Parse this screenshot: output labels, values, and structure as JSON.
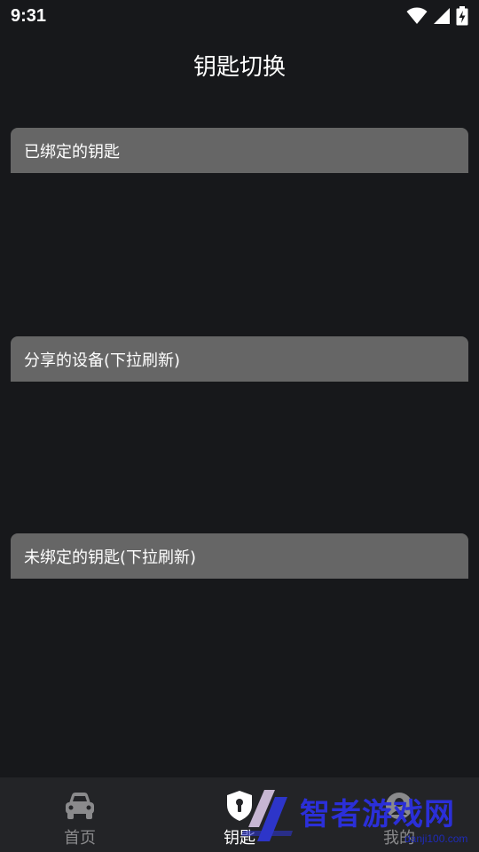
{
  "status_bar": {
    "time": "9:31",
    "icons": [
      "wifi-icon",
      "signal-icon",
      "battery-charging-icon"
    ]
  },
  "header": {
    "title": "钥匙切换"
  },
  "sections": {
    "bound": {
      "title": "已绑定的钥匙"
    },
    "shared": {
      "title": "分享的设备(下拉刷新)"
    },
    "unbound": {
      "title": "未绑定的钥匙(下拉刷新)"
    }
  },
  "bottom_nav": {
    "items": [
      {
        "label": "首页",
        "icon": "car-icon",
        "active": false
      },
      {
        "label": "钥匙",
        "icon": "key-shield-icon",
        "active": true
      },
      {
        "label": "我的",
        "icon": "profile-icon",
        "active": false
      }
    ]
  },
  "watermark": {
    "title": "智者游戏网",
    "subtitle": "danji100.com"
  },
  "colors": {
    "background": "#17181b",
    "section_header": "#666666",
    "nav_background": "#232427",
    "nav_inactive": "#8a8a8c",
    "watermark": "#2b2fd8"
  }
}
